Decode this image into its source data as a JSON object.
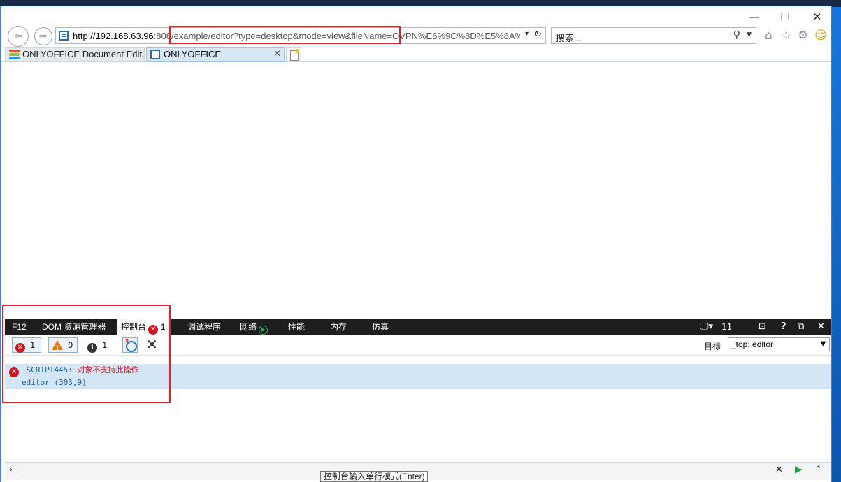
{
  "window": {
    "minimize": "—",
    "maximize": "☐",
    "close": "✕"
  },
  "address": {
    "host": "http://192.168.63.96",
    "port": ":808",
    "path": "/example/editor?type=desktop&mode=view&fileName=",
    "query_tail": "OVPN%E6%9C%8D%E5%8A%"
  },
  "search": {
    "placeholder": "搜索..."
  },
  "tabs": [
    {
      "label": "ONLYOFFICE Document Edit..."
    },
    {
      "label": "ONLYOFFICE"
    }
  ],
  "devtools": {
    "tabs": {
      "f12": "F12",
      "dom": "DOM 资源管理器",
      "console": "控制台",
      "console_error_count": "1",
      "debugger": "调试程序",
      "network": "网络",
      "performance": "性能",
      "memory": "内存",
      "emulation": "仿真"
    },
    "right": {
      "target_count": "11",
      "help": "?"
    },
    "filters": {
      "errors": "1",
      "warnings": "0",
      "info": "1"
    },
    "target": {
      "label": "目标",
      "value": "_top: editor"
    },
    "messages": [
      {
        "code": "SCRIPT445:",
        "text": "对象不支持此操作"
      },
      {
        "code": "editor (303,9)",
        "text": ""
      }
    ],
    "input_tooltip": "控制台输入单行模式(Enter)"
  }
}
